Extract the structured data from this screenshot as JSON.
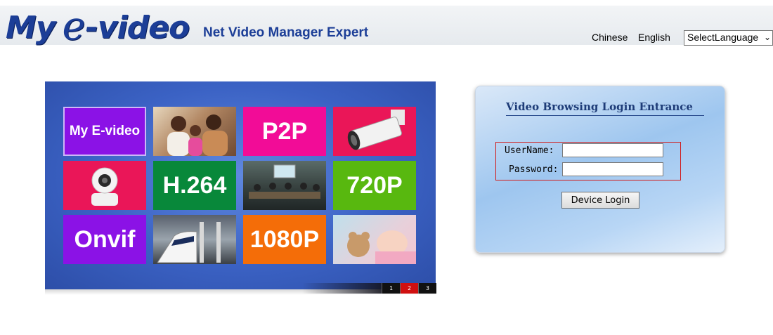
{
  "header": {
    "logo": {
      "my": "My",
      "e": "e",
      "video": "-video"
    },
    "subtitle": "Net Video Manager Expert",
    "lang_links": [
      "Chinese",
      "English"
    ],
    "lang_select": {
      "selected": "SelectLanguage"
    }
  },
  "banner": {
    "tiles": [
      {
        "text": "My E-video",
        "icon": "brand-tile"
      },
      {
        "text": "",
        "icon": "family-photo"
      },
      {
        "text": "P2P",
        "icon": ""
      },
      {
        "text": "",
        "icon": "bullet-camera-photo"
      },
      {
        "text": "",
        "icon": "ptz-camera-photo"
      },
      {
        "text": "H.264",
        "icon": ""
      },
      {
        "text": "",
        "icon": "meeting-room-photo"
      },
      {
        "text": "720P",
        "icon": ""
      },
      {
        "text": "Onvif",
        "icon": ""
      },
      {
        "text": "",
        "icon": "bullet-train-photo"
      },
      {
        "text": "1080P",
        "icon": ""
      },
      {
        "text": "",
        "icon": "sleeping-baby-photo"
      }
    ],
    "pager": {
      "pages": [
        "1",
        "2",
        "3"
      ],
      "active_index": 1
    }
  },
  "login": {
    "title": "Video Browsing Login Entrance",
    "username_label": "UserName:",
    "password_label": "Password:",
    "username_value": "",
    "password_value": "",
    "submit_label": "Device Login"
  },
  "colors": {
    "brand_blue": "#1c3e97",
    "banner_blue": "#3b62c4",
    "highlight_red": "#d01c1c",
    "tile_purple": "#8b12e6",
    "tile_magenta": "#f20c97",
    "tile_crimson": "#ea1658",
    "tile_green": "#08883a",
    "tile_lime": "#58b80f",
    "tile_orange": "#f46d08"
  }
}
